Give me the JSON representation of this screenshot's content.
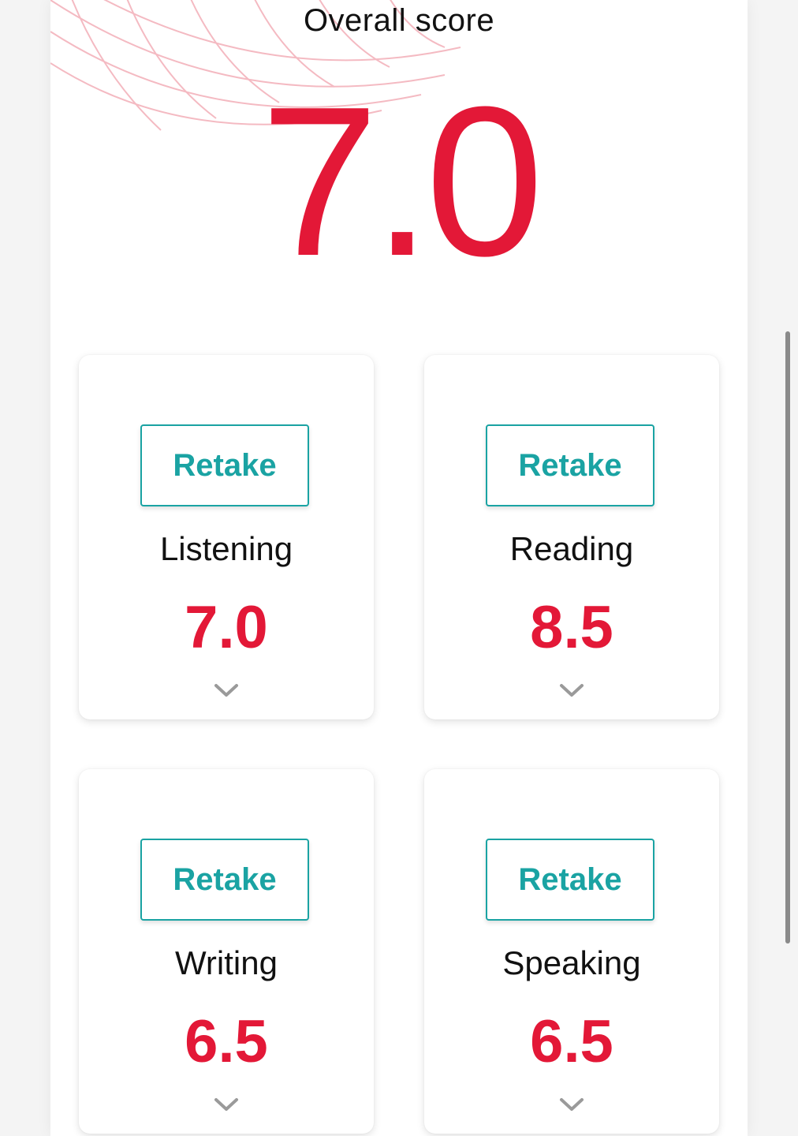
{
  "overall": {
    "title": "Overall score",
    "score": "7.0"
  },
  "sections": [
    {
      "name": "Listening",
      "score": "7.0",
      "retake_label": "Retake",
      "icon": "chevron-down-icon"
    },
    {
      "name": "Reading",
      "score": "8.5",
      "retake_label": "Retake",
      "icon": "chevron-down-icon"
    },
    {
      "name": "Writing",
      "score": "6.5",
      "retake_label": "Retake",
      "icon": "chevron-down-icon"
    },
    {
      "name": "Speaking",
      "score": "6.5",
      "retake_label": "Retake",
      "icon": "chevron-down-icon"
    }
  ],
  "colors": {
    "accent_red": "#e31837",
    "accent_teal": "#1aa3a3",
    "text_dark": "#111111",
    "chevron_gray": "#9a9a9a"
  }
}
